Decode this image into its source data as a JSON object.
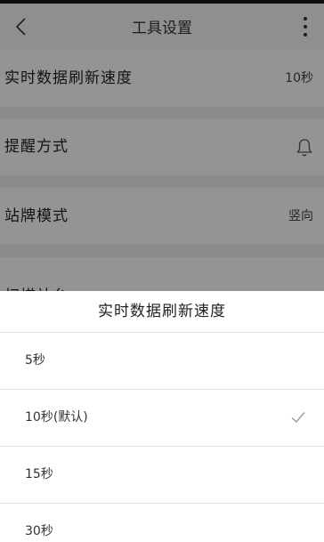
{
  "header": {
    "title": "工具设置",
    "back_icon": "chevron-left-icon",
    "more_icon": "more-vertical-icon"
  },
  "settings": [
    {
      "label": "实时数据刷新速度",
      "value": "10秒"
    },
    {
      "label": "提醒方式",
      "icon": "bell-icon"
    },
    {
      "label": "站牌模式",
      "value": "竖向"
    },
    {
      "label": "扫描站台"
    }
  ],
  "sheet": {
    "title": "实时数据刷新速度",
    "options": [
      {
        "label": "5秒",
        "selected": false
      },
      {
        "label": "10秒(默认)",
        "selected": true
      },
      {
        "label": "15秒",
        "selected": false
      },
      {
        "label": "30秒",
        "selected": false
      }
    ]
  },
  "colors": {
    "overlay": "#000000",
    "check": "#9a9a9a"
  }
}
